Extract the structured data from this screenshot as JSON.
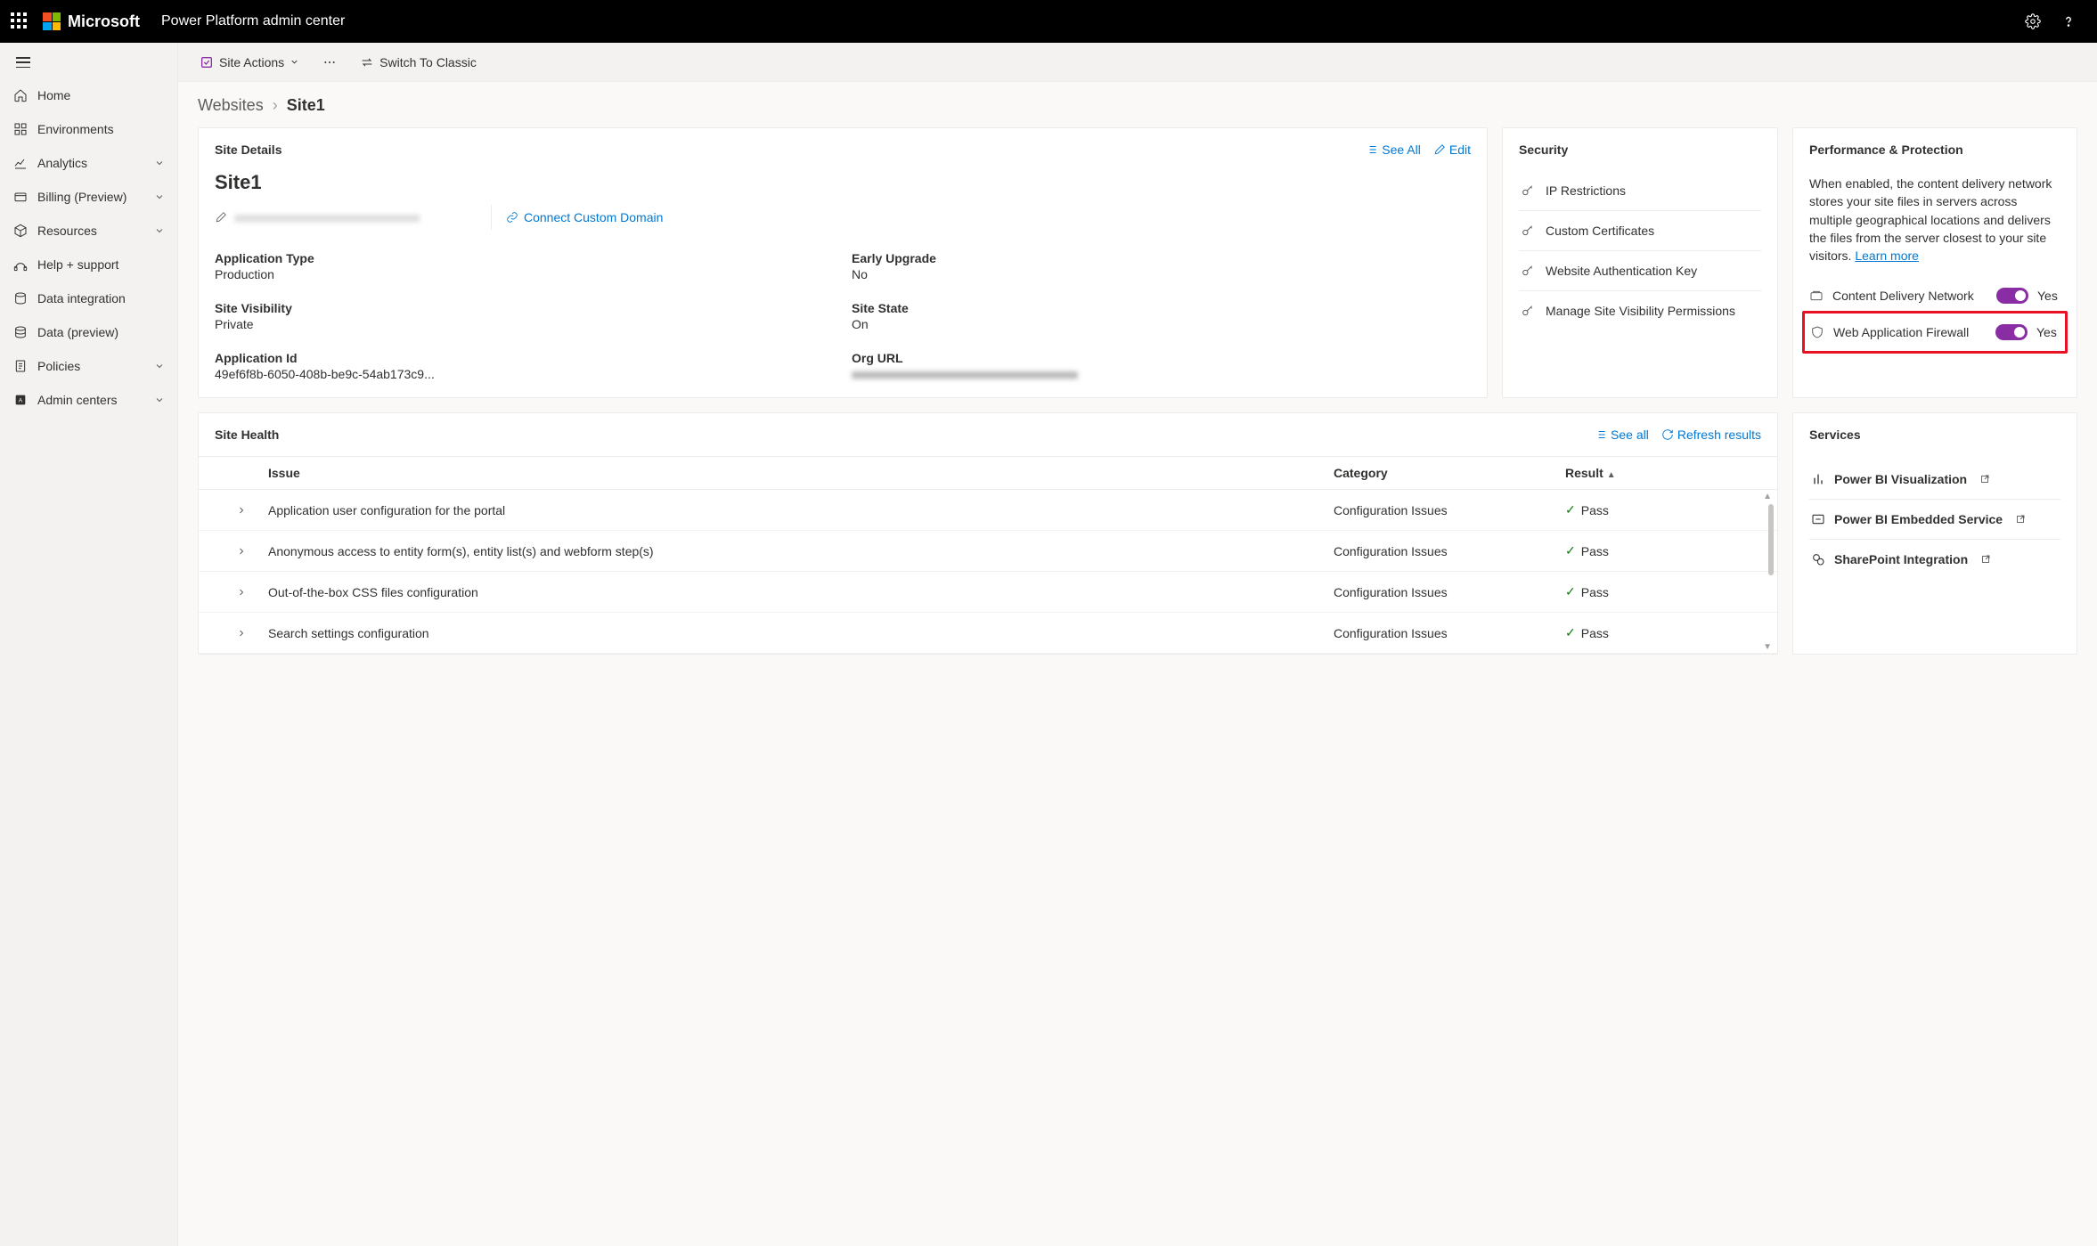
{
  "header": {
    "brand": "Microsoft",
    "app_title": "Power Platform admin center"
  },
  "sidebar": {
    "items": [
      {
        "label": "Home",
        "icon": "home"
      },
      {
        "label": "Environments",
        "icon": "environments"
      },
      {
        "label": "Analytics",
        "icon": "analytics",
        "expandable": true
      },
      {
        "label": "Billing (Preview)",
        "icon": "billing",
        "expandable": true
      },
      {
        "label": "Resources",
        "icon": "resources",
        "expandable": true
      },
      {
        "label": "Help + support",
        "icon": "help"
      },
      {
        "label": "Data integration",
        "icon": "dataintegration"
      },
      {
        "label": "Data (preview)",
        "icon": "data"
      },
      {
        "label": "Policies",
        "icon": "policies",
        "expandable": true
      },
      {
        "label": "Admin centers",
        "icon": "admincenters",
        "expandable": true
      }
    ]
  },
  "commandbar": {
    "site_actions": "Site Actions",
    "switch_classic": "Switch To Classic"
  },
  "breadcrumb": {
    "parent": "Websites",
    "current": "Site1"
  },
  "site_details": {
    "card_title": "Site Details",
    "see_all": "See All",
    "edit": "Edit",
    "site_name": "Site1",
    "domain_masked": "xxxxxxxxxxxxxxxxxxxxxxxxxxxxxxxx",
    "connect_domain": "Connect Custom Domain",
    "fields": {
      "app_type_label": "Application Type",
      "app_type_value": "Production",
      "early_upgrade_label": "Early Upgrade",
      "early_upgrade_value": "No",
      "visibility_label": "Site Visibility",
      "visibility_value": "Private",
      "state_label": "Site State",
      "state_value": "On",
      "app_id_label": "Application Id",
      "app_id_value": "49ef6f8b-6050-408b-be9c-54ab173c9...",
      "org_url_label": "Org URL",
      "org_url_value": "xxxxxxxxxxxxxxxxxxxxxxxxxxxxxxxxxxxxxxx"
    }
  },
  "security": {
    "card_title": "Security",
    "items": [
      "IP Restrictions",
      "Custom Certificates",
      "Website Authentication Key",
      "Manage Site Visibility Permissions"
    ]
  },
  "perf": {
    "card_title": "Performance & Protection",
    "description": "When enabled, the content delivery network stores your site files in servers across multiple geographical locations and delivers the files from the server closest to your site visitors. ",
    "learn_more": "Learn more",
    "cdn_label": "Content Delivery Network",
    "cdn_state": "Yes",
    "waf_label": "Web Application Firewall",
    "waf_state": "Yes"
  },
  "health": {
    "card_title": "Site Health",
    "see_all": "See all",
    "refresh": "Refresh results",
    "columns": {
      "issue": "Issue",
      "category": "Category",
      "result": "Result"
    },
    "rows": [
      {
        "issue": "Application user configuration for the portal",
        "category": "Configuration Issues",
        "result": "Pass"
      },
      {
        "issue": "Anonymous access to entity form(s), entity list(s) and webform step(s)",
        "category": "Configuration Issues",
        "result": "Pass"
      },
      {
        "issue": "Out-of-the-box CSS files configuration",
        "category": "Configuration Issues",
        "result": "Pass"
      },
      {
        "issue": "Search settings configuration",
        "category": "Configuration Issues",
        "result": "Pass"
      }
    ]
  },
  "services": {
    "card_title": "Services",
    "items": [
      "Power BI Visualization",
      "Power BI Embedded Service",
      "SharePoint Integration"
    ]
  }
}
